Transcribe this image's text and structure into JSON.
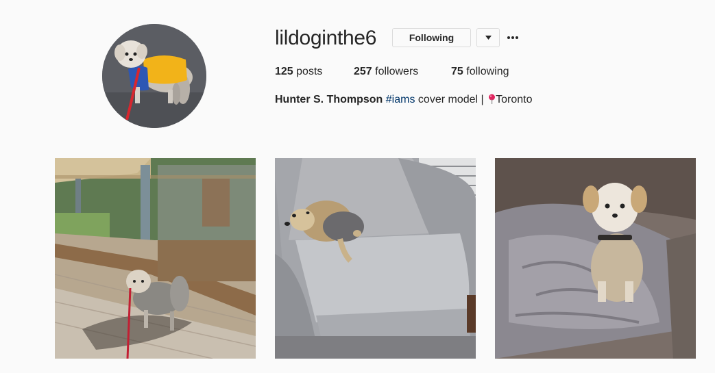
{
  "profile": {
    "username": "lildoginthe6",
    "follow_button_label": "Following",
    "stats": {
      "posts_count": "125",
      "posts_label": " posts",
      "followers_count": "257",
      "followers_label": " followers",
      "following_count": "75",
      "following_label": " following"
    },
    "bio": {
      "name": "Hunter S. Thompson",
      "hashtag": "#iams",
      "text": " cover model |  ",
      "location": "Toronto"
    }
  },
  "icons": {
    "dropdown": "chevron-down-icon",
    "more": "more-options-icon",
    "location": "map-pin-icon"
  },
  "colors": {
    "background": "#fafafa",
    "text": "#262626",
    "border": "#dbdbdb",
    "hashtag": "#003569",
    "pin": "#e0245e"
  }
}
